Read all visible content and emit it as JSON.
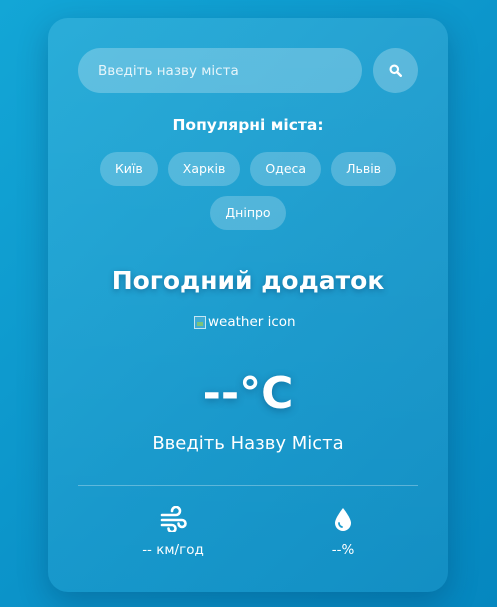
{
  "search": {
    "placeholder": "Введіть назву міста",
    "button_icon": "search-icon"
  },
  "popular": {
    "title": "Популярні міста:",
    "cities": [
      "Київ",
      "Харків",
      "Одеса",
      "Львів",
      "Дніпро"
    ]
  },
  "weather": {
    "app_title": "Погодний додаток",
    "icon_alt": "weather icon",
    "temperature": "--°C",
    "city": "Введіть Назву Міста"
  },
  "details": {
    "wind": {
      "icon": "wind-icon",
      "value": "-- км/год"
    },
    "humidity": {
      "icon": "water-drop-icon",
      "value": "--%"
    }
  },
  "colors": {
    "background": "#0b93c9",
    "text": "#ffffff"
  }
}
